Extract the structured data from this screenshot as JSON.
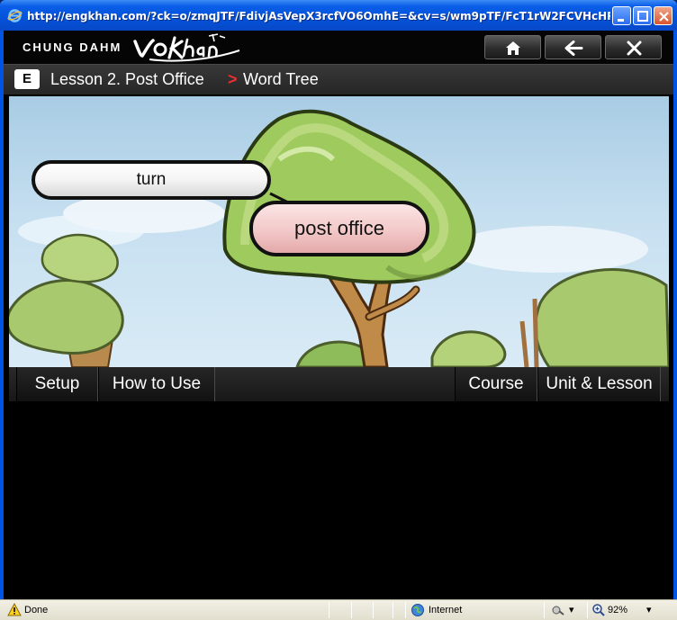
{
  "window": {
    "title": "http://engkhan.com/?ck=o/zmqJTF/FdivjAsVepX3rcfVO6OmhE=&cv=s/wm9pTF/FcT1rW2FCVHcHR*Cr..."
  },
  "app": {
    "brand": "CHUNG DAHM",
    "logo": "VoKhan",
    "breadcrumb": {
      "badge": "E",
      "lesson": "Lesson 2. Post Office",
      "separator": ">",
      "page": "Word Tree"
    }
  },
  "scene": {
    "words": [
      "turn",
      "post office"
    ]
  },
  "navbar": {
    "setup": "Setup",
    "how_to_use": "How to Use",
    "course": "Course",
    "unit_lesson": "Unit & Lesson"
  },
  "statusbar": {
    "status": "Done",
    "zone": "Internet",
    "zoom": "92%"
  },
  "colors": {
    "accent_red": "#e83030",
    "pill_pink": "#f3c8c8"
  }
}
